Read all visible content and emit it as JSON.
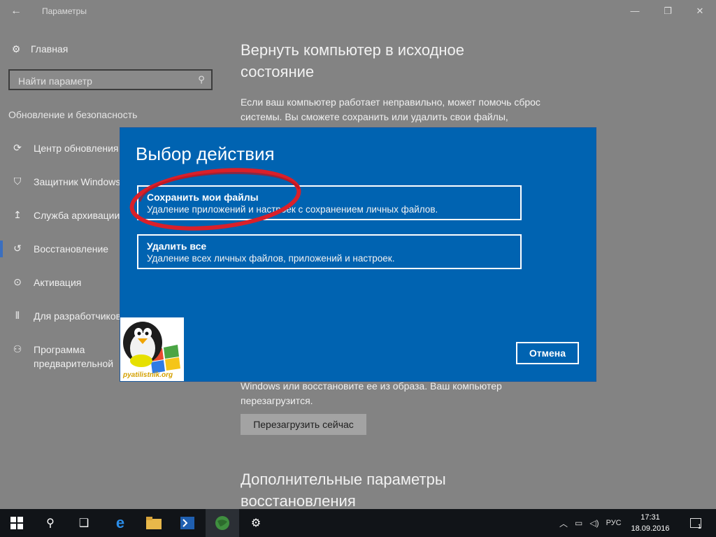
{
  "window": {
    "title": "Параметры"
  },
  "sidebar": {
    "home_label": "Главная",
    "search_placeholder": "Найти параметр",
    "section_title": "Обновление и безопасность",
    "items": [
      {
        "label": "Центр обновления",
        "icon": "sync-icon"
      },
      {
        "label": "Защитник Windows",
        "icon": "shield-icon"
      },
      {
        "label": "Служба архивации",
        "icon": "backup-arrow-icon"
      },
      {
        "label": "Восстановление",
        "icon": "history-icon",
        "active": true
      },
      {
        "label": "Активация",
        "icon": "check-circle-icon"
      },
      {
        "label": "Для разработчиков",
        "icon": "developer-icon"
      },
      {
        "label": "Программа предварительной оценки Windows",
        "icon": "person-icon"
      }
    ]
  },
  "content": {
    "heading": "Вернуть компьютер в исходное состояние",
    "paragraph": "Если ваш компьютер работает неправильно, может помочь сброс системы. Вы сможете сохранить или удалить свои файлы,",
    "paragraph2": "Windows или восстановите ее из образа. Ваш компьютер перезагрузится.",
    "restart_button": "Перезагрузить сейчас",
    "more_heading": "Дополнительные параметры восстановления"
  },
  "modal": {
    "title": "Выбор действия",
    "options": [
      {
        "title": "Сохранить мои файлы",
        "description": "Удаление приложений и настроек с сохранением личных файлов."
      },
      {
        "title": "Удалить все",
        "description": "Удаление всех личных файлов, приложений и настроек."
      }
    ],
    "cancel_label": "Отмена",
    "watermark": "pyatilistnik.org"
  },
  "taskbar": {
    "language": "РУС",
    "time": "17:31",
    "date": "18.09.2016",
    "notification_count": "1"
  },
  "colors": {
    "modal_bg": "#0063b1",
    "annotation": "#d9202a",
    "active_indicator": "#3b6fbf"
  }
}
